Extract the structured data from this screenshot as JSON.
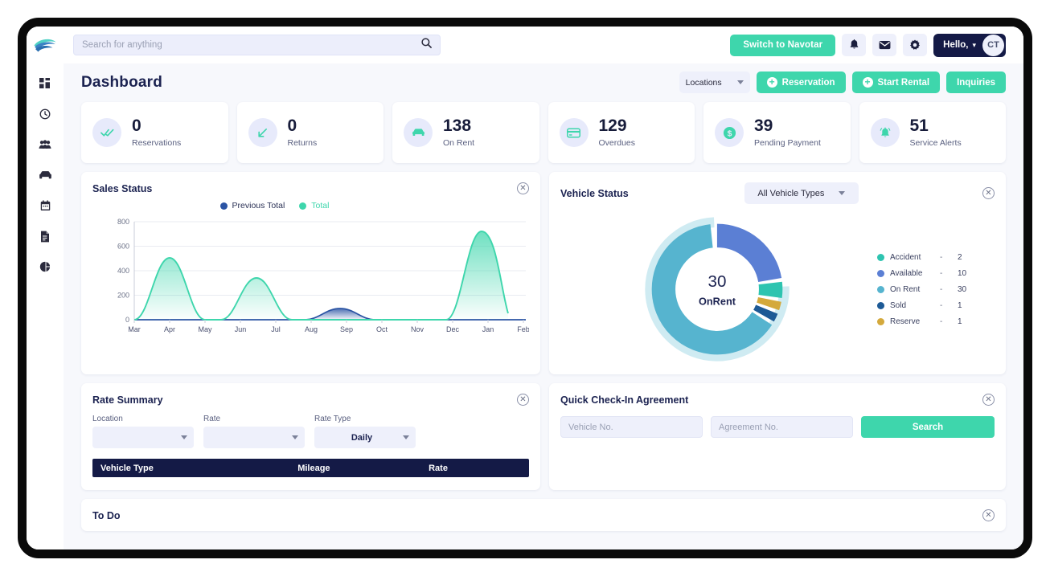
{
  "topbar": {
    "search_placeholder": "Search for anything",
    "search_value": "",
    "search_icon": "search-icon",
    "switch_label": "Switch to Navotar",
    "bell_icon": "bell-icon",
    "mail_icon": "mail-icon",
    "gear_icon": "gear-icon",
    "hello_label": "Hello,",
    "avatar_initials": "CT"
  },
  "page": {
    "title": "Dashboard",
    "locations_label": "Locations",
    "reservation_label": "Reservation",
    "start_rental_label": "Start Rental",
    "inquiries_label": "Inquiries"
  },
  "sidebar": {
    "items": [
      {
        "name": "dashboard",
        "icon": "grid-icon"
      },
      {
        "name": "history",
        "icon": "clock-icon"
      },
      {
        "name": "customers",
        "icon": "users-icon"
      },
      {
        "name": "vehicles",
        "icon": "car-icon"
      },
      {
        "name": "calendar",
        "icon": "calendar-icon"
      },
      {
        "name": "reports",
        "icon": "document-icon"
      },
      {
        "name": "analytics",
        "icon": "pie-chart-icon"
      }
    ]
  },
  "stats": [
    {
      "value": "0",
      "label": "Reservations",
      "icon": "double-check-icon"
    },
    {
      "value": "0",
      "label": "Returns",
      "icon": "arrow-down-left-icon"
    },
    {
      "value": "138",
      "label": "On Rent",
      "icon": "car-icon"
    },
    {
      "value": "129",
      "label": "Overdues",
      "icon": "credit-card-icon"
    },
    {
      "value": "39",
      "label": "Pending Payment",
      "icon": "dollar-icon"
    },
    {
      "value": "51",
      "label": "Service Alerts",
      "icon": "bell-alert-icon"
    }
  ],
  "sales_panel": {
    "title": "Sales Status",
    "close_icon": "close-circle-icon"
  },
  "vehicle_panel": {
    "title": "Vehicle Status",
    "filter_label": "All Vehicle Types",
    "close_icon": "close-circle-icon",
    "center_value": "30",
    "center_label": "OnRent"
  },
  "rate_panel": {
    "title": "Rate Summary",
    "close_icon": "close-circle-icon",
    "location_label": "Location",
    "location_value": "",
    "rate_label": "Rate",
    "rate_value": "",
    "rate_type_label": "Rate Type",
    "rate_type_value": "Daily",
    "col_vehicle_type": "Vehicle Type",
    "col_mileage": "Mileage",
    "col_rate": "Rate"
  },
  "quick_panel": {
    "title": "Quick Check-In Agreement",
    "close_icon": "close-circle-icon",
    "vehicle_placeholder": "Vehicle No.",
    "vehicle_value": "",
    "agreement_placeholder": "Agreement No.",
    "agreement_value": "",
    "search_label": "Search"
  },
  "todo_panel": {
    "title": "To Do"
  },
  "colors": {
    "accent_green": "#3ed6ac",
    "navy": "#141a46",
    "lavender": "#eef0fb",
    "series_total": "#3ed6ac",
    "series_previous": "#2b54a4",
    "accident": "#2ec4b0",
    "available": "#5b7fd4",
    "on_rent": "#56b4cf",
    "sold": "#1d5a96",
    "reserve": "#d4a93c"
  },
  "chart_data": [
    {
      "type": "area",
      "title": "Sales Status",
      "xlabel": "",
      "ylabel": "",
      "ylim": [
        0,
        800
      ],
      "yticks": [
        0,
        200,
        400,
        600,
        800
      ],
      "grid": true,
      "legend_position": "top-center",
      "categories": [
        "Mar",
        "Apr",
        "May",
        "Jun",
        "Jul",
        "Aug",
        "Sep",
        "Oct",
        "Nov",
        "Dec",
        "Jan",
        "Feb"
      ],
      "series": [
        {
          "name": "Previous Total",
          "color": "#2b54a4",
          "values": [
            0,
            0,
            0,
            0,
            0,
            0,
            95,
            0,
            0,
            0,
            0,
            0
          ]
        },
        {
          "name": "Total",
          "color": "#3ed6ac",
          "values": [
            0,
            505,
            0,
            340,
            0,
            0,
            0,
            0,
            0,
            0,
            720,
            80
          ]
        }
      ]
    },
    {
      "type": "pie",
      "title": "Vehicle Status",
      "center_value": "30",
      "center_label": "OnRent",
      "legend_position": "right",
      "categories": [
        "Accident",
        "Available",
        "On Rent",
        "Sold",
        "Reserve"
      ],
      "values": [
        2,
        10,
        30,
        1,
        1
      ],
      "colors": [
        "#2ec4b0",
        "#5b7fd4",
        "#56b4cf",
        "#1d5a96",
        "#d4a93c"
      ]
    }
  ],
  "rate_table": {
    "rows": []
  }
}
